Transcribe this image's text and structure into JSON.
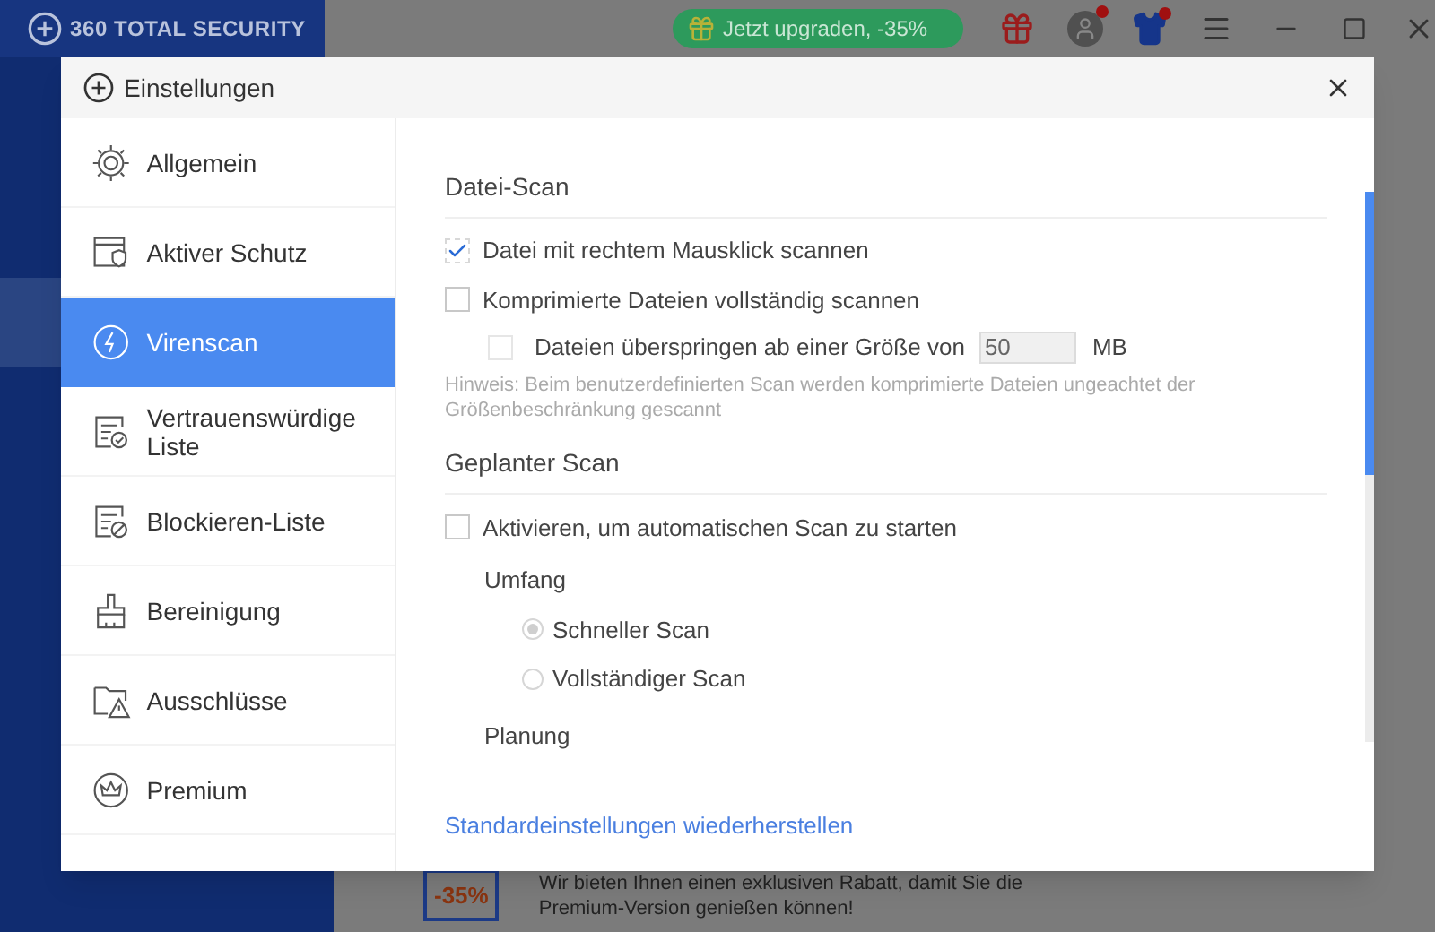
{
  "app": {
    "title": "360 TOTAL SECURITY",
    "upgrade_button": "Jetzt upgraden, -35%",
    "promo": {
      "badge": "-35%",
      "text_lines": [
        "Wir bieten Ihnen einen exklusiven Rabatt, damit Sie die",
        "Premium-Version genießen können!"
      ]
    }
  },
  "dialog": {
    "title": "Einstellungen",
    "sidebar": [
      {
        "label": "Allgemein",
        "kind": "gear",
        "selected": false
      },
      {
        "label": "Aktiver Schutz",
        "kind": "shield",
        "selected": false
      },
      {
        "label": "Virenscan",
        "kind": "scan",
        "selected": true
      },
      {
        "label": "Vertrauenswürdige Liste",
        "kind": "trust",
        "selected": false
      },
      {
        "label": "Blockieren-Liste",
        "kind": "block",
        "selected": false
      },
      {
        "label": "Bereinigung",
        "kind": "broom",
        "selected": false
      },
      {
        "label": "Ausschlüsse",
        "kind": "folder",
        "selected": false
      },
      {
        "label": "Premium",
        "kind": "crown",
        "selected": false
      }
    ],
    "file_scan": {
      "heading": "Datei-Scan",
      "options": [
        {
          "label": "Datei mit rechtem Mausklick scannen",
          "checked": true
        },
        {
          "label": "Komprimierte Dateien vollständig scannen",
          "checked": false
        }
      ],
      "size_limit": {
        "label": "Dateien überspringen ab einer Größe von",
        "checked": false,
        "value": "50",
        "unit": "MB"
      },
      "hint": "Hinweis: Beim benutzerdefinierten Scan werden komprimierte Dateien ungeachtet der Größenbeschränkung gescannt"
    },
    "scheduled_scan": {
      "heading": "Geplanter Scan",
      "enable": {
        "label": "Aktivieren, um automatischen Scan zu starten",
        "checked": false
      },
      "scope": {
        "label": "Umfang",
        "options": [
          {
            "label": "Schneller Scan",
            "selected": true
          },
          {
            "label": "Vollständiger Scan",
            "selected": false
          }
        ]
      },
      "planning_label": "Planung"
    },
    "restore_link": "Standardeinstellungen wiederherstellen"
  }
}
